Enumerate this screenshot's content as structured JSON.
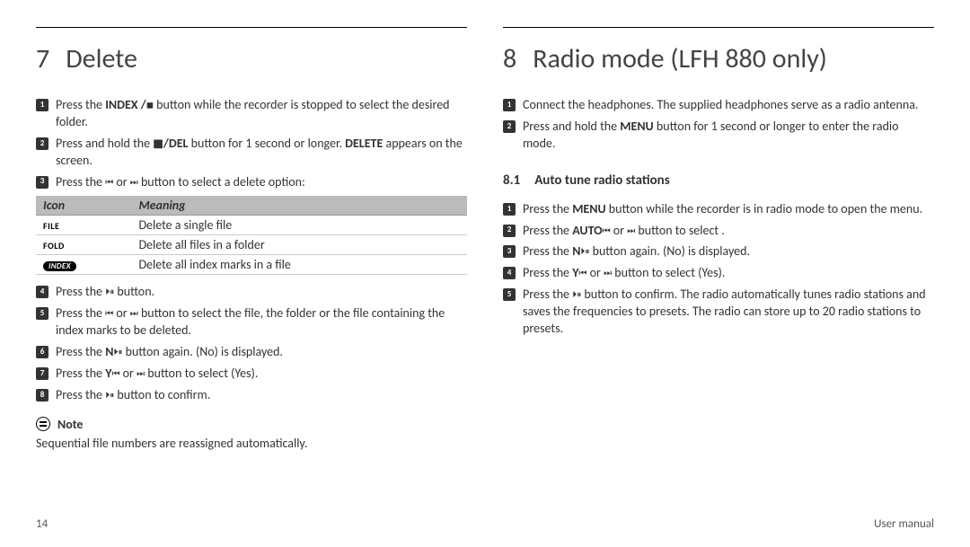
{
  "left": {
    "num": "7",
    "title": "Delete",
    "steps1": [
      {
        "n": "1",
        "pre": "Press the ",
        "bold": "INDEX /",
        "sym": "◼",
        "post": " button while the recorder is stopped to select the desired folder."
      },
      {
        "n": "2",
        "pre": "Press and hold the ",
        "bold": "◼/DEL",
        "post": " button for 1 second or longer. ",
        "bold2": "DELETE",
        "post2": " appears on the screen."
      },
      {
        "n": "3",
        "pre": "Press the ",
        "sym": "⏮",
        "mid": " or ",
        "sym2": "⏭",
        "post": " button to select a delete option:"
      }
    ],
    "table": {
      "h1": "Icon",
      "h2": "Meaning",
      "rows": [
        {
          "icon": "FILE",
          "meaning": "Delete a single file"
        },
        {
          "icon": "FOLD",
          "meaning": "Delete all files in a folder"
        },
        {
          "icon": "INDEX",
          "meaning": "Delete all index marks in a file",
          "badge": true
        }
      ]
    },
    "steps2": [
      {
        "n": "4",
        "pre": "Press the ",
        "sym": "⏵⏸",
        "post": " button."
      },
      {
        "n": "5",
        "pre": "Press the ",
        "sym": "⏮",
        "mid": " or ",
        "sym2": "⏭",
        "post": " button to select the file, the folder or the file containing the index marks to be deleted."
      },
      {
        "n": "6",
        "pre": "Press the ",
        "sym": "⏵⏸",
        "post": " button again. ",
        "bold": "N",
        "post2": " (No) is displayed."
      },
      {
        "n": "7",
        "pre": "Press the ",
        "sym": "⏮",
        "mid": " or ",
        "sym2": "⏭",
        "post": " button to select ",
        "bold": "Y",
        "post2": " (Yes)."
      },
      {
        "n": "8",
        "pre": "Press the ",
        "sym": "⏵⏸",
        "post": " button to confirm."
      }
    ],
    "note_label": "Note",
    "note_text": "Sequential file numbers are reassigned automatically."
  },
  "right": {
    "num": "8",
    "title": "Radio mode (LFH 880 only)",
    "steps1": [
      {
        "n": "1",
        "text": "Connect the headphones. The supplied headphones serve as a radio antenna."
      },
      {
        "n": "2",
        "pre": "Press and hold the ",
        "bold": "MENU",
        "post": " button for 1 second or longer to enter the radio mode."
      }
    ],
    "sub_num": "8.1",
    "sub_title": "Auto tune radio stations",
    "steps2": [
      {
        "n": "1",
        "pre": "Press the ",
        "bold": "MENU",
        "post": " button while the recorder is in radio mode to open the menu."
      },
      {
        "n": "2",
        "pre": "Press the ",
        "sym": "⏮",
        "mid": " or ",
        "sym2": "⏭",
        "post": " button to select ",
        "bold": "AUTO",
        "post2": "."
      },
      {
        "n": "3",
        "pre": "Press the ",
        "sym": "⏵⏸",
        "post": " button again. ",
        "bold": "N",
        "post2": " (No) is displayed."
      },
      {
        "n": "4",
        "pre": "Press the ",
        "sym": "⏮",
        "mid": " or ",
        "sym2": "⏭",
        "post": " button to select ",
        "bold": "Y",
        "post2": " (Yes)."
      },
      {
        "n": "5",
        "pre": "Press the ",
        "sym": "⏵⏸",
        "post": " button to confirm. The radio automatically tunes radio stations and saves the frequencies to presets. The radio can store up to 20 radio stations to presets."
      }
    ]
  },
  "footer": {
    "page": "14",
    "label": "User manual"
  }
}
